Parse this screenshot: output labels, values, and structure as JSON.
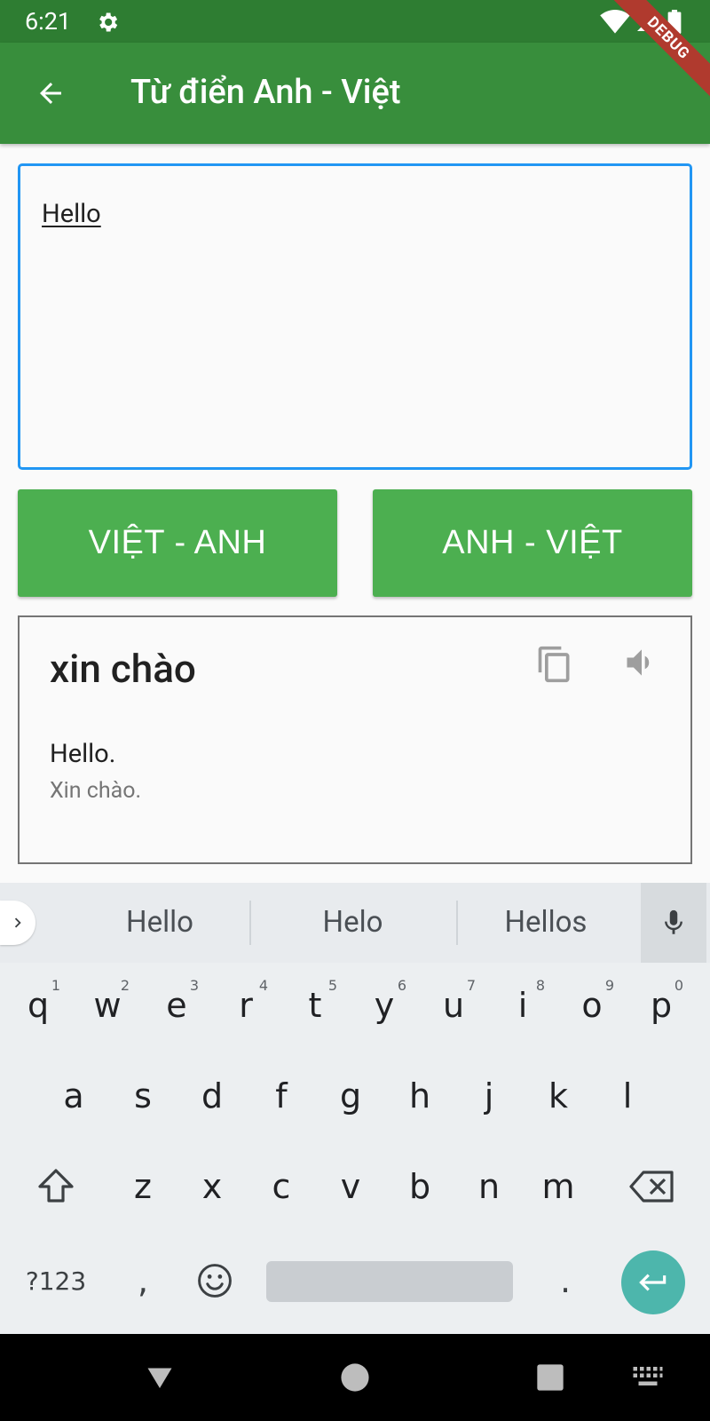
{
  "status_bar": {
    "time": "6:21"
  },
  "debug_banner": "DEBUG",
  "app_bar": {
    "title": "Từ điển Anh - Việt"
  },
  "input": {
    "value": "Hello"
  },
  "buttons": {
    "viet_anh": "VIỆT - ANH",
    "anh_viet": "ANH - VIỆT"
  },
  "result": {
    "word": "xin chào",
    "example_en": "Hello.",
    "example_vi": "Xin chào."
  },
  "keyboard": {
    "suggestions": [
      "Hello",
      "Helo",
      "Hellos"
    ],
    "row1": [
      {
        "key": "q",
        "hint": "1"
      },
      {
        "key": "w",
        "hint": "2"
      },
      {
        "key": "e",
        "hint": "3"
      },
      {
        "key": "r",
        "hint": "4"
      },
      {
        "key": "t",
        "hint": "5"
      },
      {
        "key": "y",
        "hint": "6"
      },
      {
        "key": "u",
        "hint": "7"
      },
      {
        "key": "i",
        "hint": "8"
      },
      {
        "key": "o",
        "hint": "9"
      },
      {
        "key": "p",
        "hint": "0"
      }
    ],
    "row2": [
      "a",
      "s",
      "d",
      "f",
      "g",
      "h",
      "j",
      "k",
      "l"
    ],
    "row3": [
      "z",
      "x",
      "c",
      "v",
      "b",
      "n",
      "m"
    ],
    "symbols_label": "?123",
    "comma": ",",
    "period": "."
  },
  "colors": {
    "status_bar": "#2e7d32",
    "app_bar": "#388e3c",
    "button": "#4caf50",
    "input_focus": "#2196f3",
    "enter_key": "#4db6ac"
  },
  "icons": {
    "back": "arrow-back-icon",
    "copy": "copy-icon",
    "speaker": "volume-icon",
    "mic": "mic-icon",
    "shift": "shift-icon",
    "backspace": "backspace-icon",
    "emoji": "emoji-icon",
    "enter": "enter-icon"
  }
}
